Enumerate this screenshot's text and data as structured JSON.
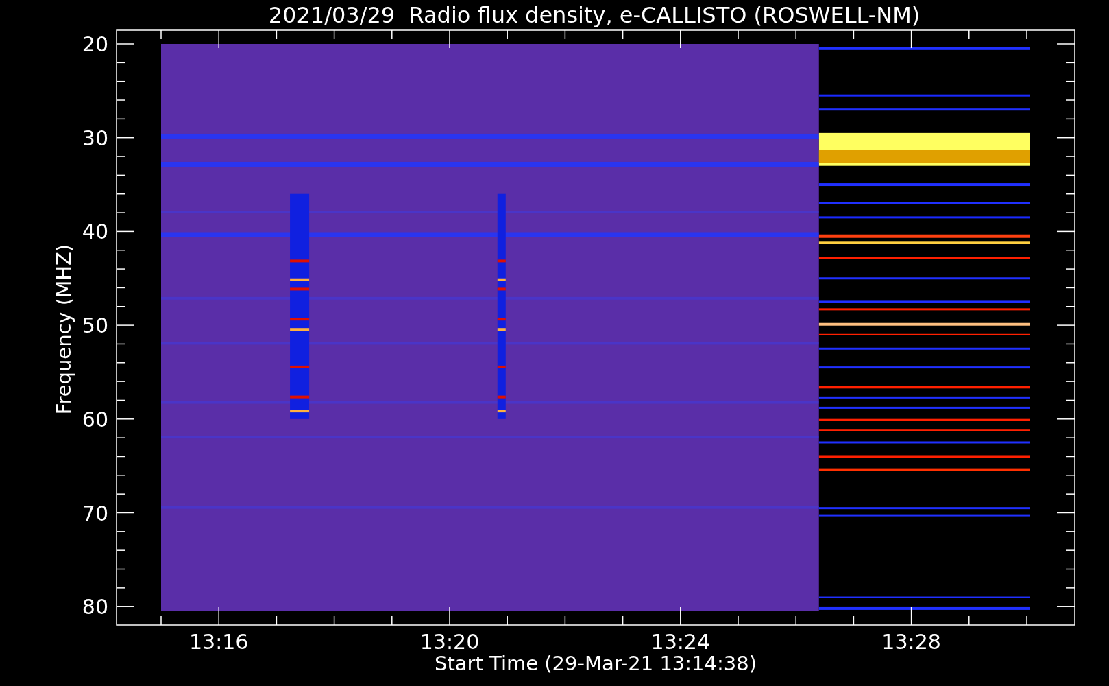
{
  "title": "2021/03/29  Radio flux density, e-CALLISTO (ROSWELL-NM)",
  "y_axis": {
    "label": "Frequency (MHZ)",
    "ticks": [
      "20",
      "30",
      "40",
      "50",
      "60",
      "70",
      "80"
    ]
  },
  "x_axis": {
    "label": "Start Time (29-Mar-21 13:14:38)",
    "ticks": [
      "13:16",
      "13:20",
      "13:24",
      "13:28"
    ]
  }
}
